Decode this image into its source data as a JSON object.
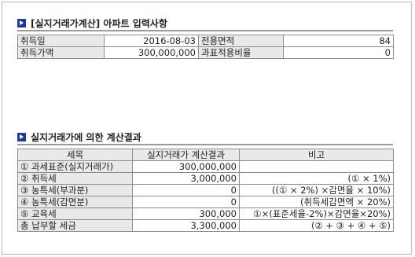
{
  "input_section": {
    "title": "[실지거래가계산] 아파트 입력사항",
    "rows": [
      {
        "label1": "취득일",
        "value1": "2016-08-03",
        "label2": "전용면적",
        "value2": "84"
      },
      {
        "label1": "취득가액",
        "value1": "300,000,000",
        "label2": "과표적용비율",
        "value2": "0"
      }
    ]
  },
  "result_section": {
    "title": "실지거래가에 의한 계산결과",
    "headers": {
      "item": "세목",
      "result": "실지거래가 계산결과",
      "note": "비고"
    },
    "rows": [
      {
        "item": "① 과세표준(실지거래가)",
        "result": "300,000,000",
        "note": ""
      },
      {
        "item": "② 취득세",
        "result": "3,000,000",
        "note": "(① × 1%)"
      },
      {
        "item": "③ 농특세(부과분)",
        "result": "0",
        "note": "((① × 2%) ×감면율 × 10%)"
      },
      {
        "item": "④ 농특세(감면분)",
        "result": "0",
        "note": "(취득세감면액 × 20%)"
      },
      {
        "item": "⑤ 교육세",
        "result": "300,000",
        "note": "①×(표준세율-2%)×감면율×20%)"
      },
      {
        "item": "총 납부할 세금",
        "result": "3,300,000",
        "note": "(② + ③ + ④ + ⑤)"
      }
    ]
  }
}
